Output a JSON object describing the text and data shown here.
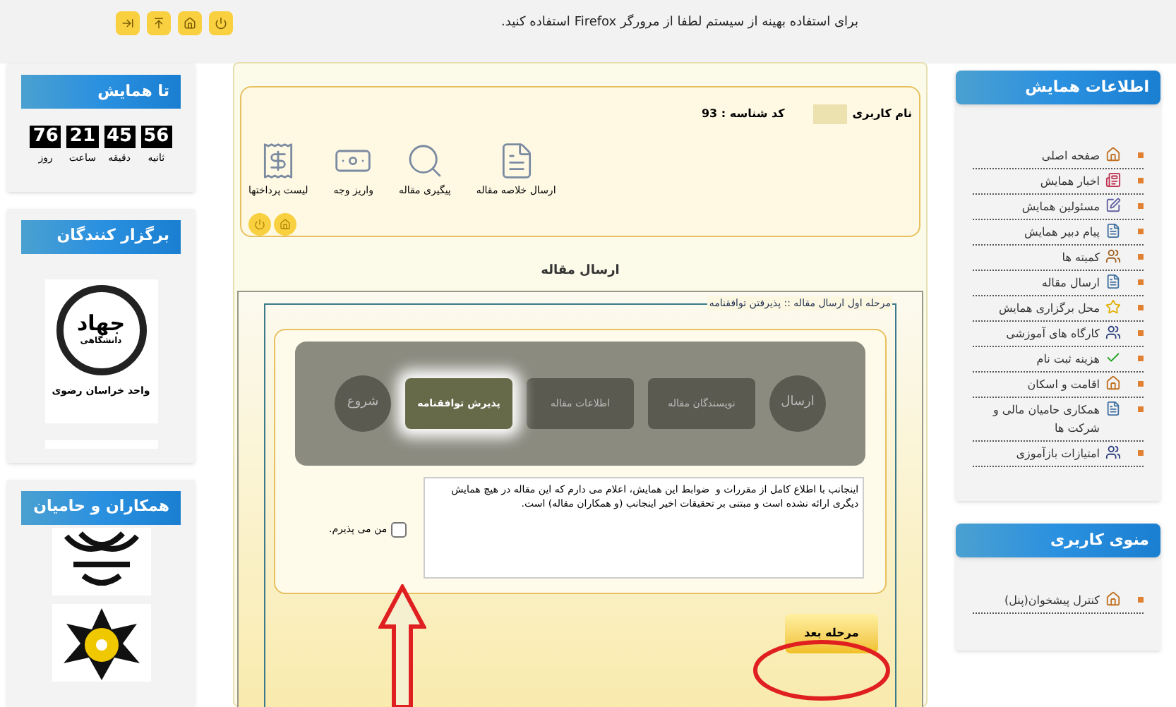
{
  "top_bar": {
    "notice": "برای استفاده بهینه از سیستم لطفا از مرورگر Firefox استفاده کنید."
  },
  "countdown": {
    "title": "تا همایش",
    "units": [
      {
        "value": "56",
        "label": "ثانیه"
      },
      {
        "value": "45",
        "label": "دقیقه"
      },
      {
        "value": "21",
        "label": "ساعت"
      },
      {
        "value": "76",
        "label": "روز"
      }
    ]
  },
  "organizers": {
    "title": "برگزار کنندگان",
    "logo_texts": [
      "جهاد",
      "دانشگاهی",
      "واحد خراسان رضوی"
    ]
  },
  "sponsors": {
    "title": "همکاران و حامیان"
  },
  "user_panel": {
    "username_label": "نام کاربری",
    "id_text": "کد شناسه : 93",
    "actions": [
      "ارسال خلاصه مقاله",
      "پیگیری مقاله",
      "واریز وجه",
      "لیست پرداختها"
    ]
  },
  "section_title": "ارسال مقاله",
  "wizard": {
    "legend": "مرحله اول ارسال مقاله :: پذیرفتن توافقنامه",
    "steps": [
      {
        "label": "ارسال",
        "kind": "circle",
        "selected": false
      },
      {
        "label": "نویسندگان مقاله",
        "kind": "box",
        "selected": false
      },
      {
        "label": "اطلاعات مقاله",
        "kind": "box",
        "selected": false
      },
      {
        "label": "پذیرش توافقنامه",
        "kind": "box",
        "selected": true
      },
      {
        "label": "شروع",
        "kind": "circle",
        "selected": false
      }
    ],
    "agreement": "اینجانب با اطلاع کامل از مقررات و  ضوابط این همایش، اعلام می دارم که این مقاله در هیچ همایش دیگری ارائه نشده است و مبتنی بر تحقیقات اخیر اینجانب (و همکاران مقاله) است.",
    "accept": {
      "label": "من می پذیرم.",
      "checked": false
    },
    "next_button": "مرحله بعد"
  },
  "conference_menu": {
    "title": "اطلاعات همایش",
    "items": [
      "صفحه اصلی",
      "اخبار همایش",
      "مسئولین همایش",
      "پیام دبیر همایش",
      "کمیته ها",
      "ارسال مقاله",
      "محل برگزاری همایش",
      "کارگاه های آموزشی",
      "هزینه ثبت نام",
      "اقامت و اسکان",
      "همکاری حامیان مالی و شرکت ها",
      "امتیازات بازآموزی"
    ]
  },
  "user_menu": {
    "title": "منوی کاربری",
    "items": [
      "کنترل پیشخوان(پنل)"
    ]
  }
}
